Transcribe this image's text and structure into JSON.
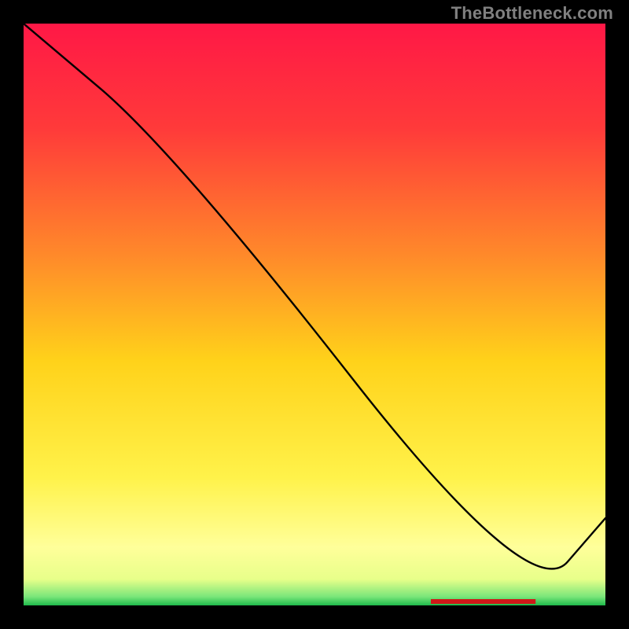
{
  "watermark": "TheBottleneck.com",
  "chart_data": {
    "type": "line",
    "title": "",
    "xlabel": "",
    "ylabel": "",
    "xlim": [
      0,
      100
    ],
    "ylim": [
      0,
      100
    ],
    "series": [
      {
        "name": "curve",
        "x": [
          0,
          26,
          87,
          100
        ],
        "y": [
          100,
          78,
          0,
          15
        ]
      }
    ],
    "labels": [
      {
        "text": "",
        "x": 78,
        "y": 1
      }
    ],
    "background_gradient": {
      "stops": [
        {
          "offset": 0.0,
          "color": "#ff1846"
        },
        {
          "offset": 0.18,
          "color": "#ff3a3a"
        },
        {
          "offset": 0.4,
          "color": "#ff8a2a"
        },
        {
          "offset": 0.58,
          "color": "#ffd21a"
        },
        {
          "offset": 0.78,
          "color": "#fff24a"
        },
        {
          "offset": 0.9,
          "color": "#ffff9a"
        },
        {
          "offset": 0.955,
          "color": "#e8ff8a"
        },
        {
          "offset": 0.985,
          "color": "#7ae67a"
        },
        {
          "offset": 1.0,
          "color": "#1fba4c"
        }
      ]
    }
  },
  "red_label_text": ""
}
